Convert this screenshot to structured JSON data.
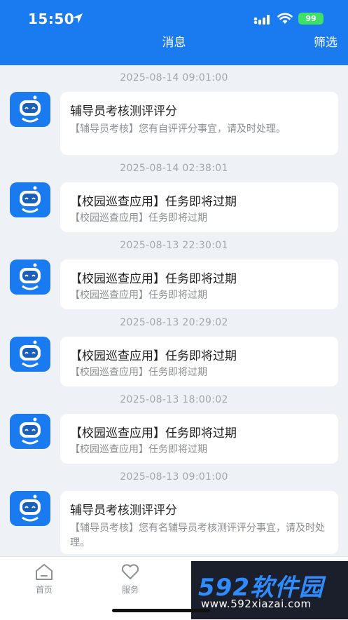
{
  "status_bar": {
    "time": "15:50",
    "battery": "99"
  },
  "header": {
    "title": "消息",
    "filter_label": "筛选"
  },
  "messages": [
    {
      "time": "2025-08-14 09:01:00",
      "title": "辅导员考核测评评分",
      "body": "【辅导员考核】您有自评评分事宜，请及时处理。"
    },
    {
      "time": "2025-08-14 02:38:01",
      "title": "【校园巡查应用】任务即将过期",
      "body": "【校园巡查应用】任务即将过期"
    },
    {
      "time": "2025-08-13 22:30:01",
      "title": "【校园巡查应用】任务即将过期",
      "body": "【校园巡查应用】任务即将过期"
    },
    {
      "time": "2025-08-13 20:29:02",
      "title": "【校园巡查应用】任务即将过期",
      "body": "【校园巡查应用】任务即将过期"
    },
    {
      "time": "2025-08-13 18:00:02",
      "title": "【校园巡查应用】任务即将过期",
      "body": "【校园巡查应用】任务即将过期"
    },
    {
      "time": "2025-08-13 09:01:00",
      "title": "辅导员考核测评评分",
      "body": "【辅导员考核】您有名辅导员考核测评评分事宜，请及时处理。"
    }
  ],
  "tabbar": [
    {
      "label": "首页",
      "icon": "home-icon"
    },
    {
      "label": "服务",
      "icon": "heart-icon"
    }
  ],
  "watermark": {
    "brand": "592软件园",
    "url": "www.592xiazai.com"
  }
}
